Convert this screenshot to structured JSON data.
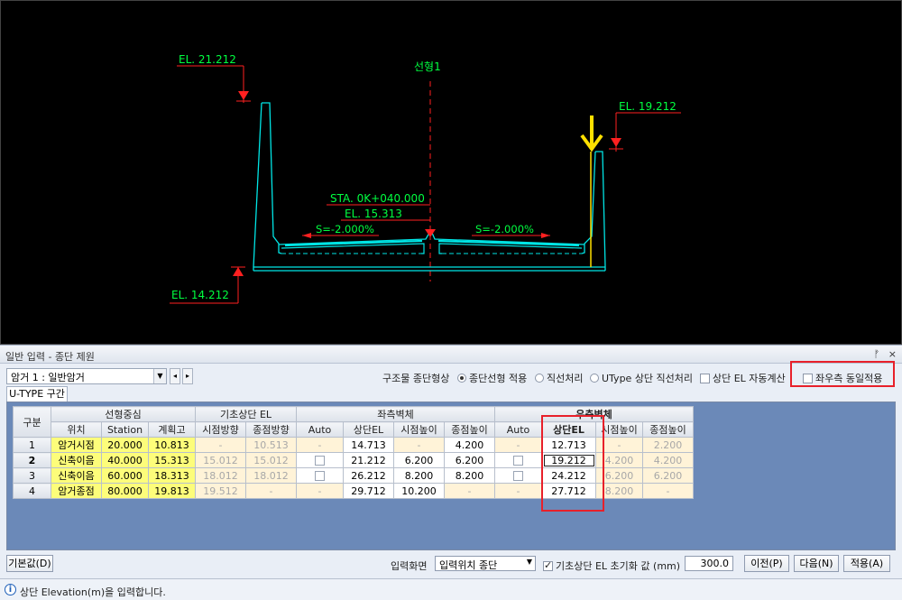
{
  "cad": {
    "labels": {
      "el_left_top": "EL. 21.212",
      "el_right_top": "EL. 19.212",
      "el_bottom": "EL. 14.212",
      "station": "STA. 0K+040.000",
      "el_center": "EL. 15.313",
      "slope_left": "S=-2.000%",
      "slope_right": "S=-2.000%",
      "alignment": "선형1"
    },
    "colors": {
      "structure": "#00e5e5",
      "text": "#00ff40",
      "marker": "#ff2020",
      "highlight": "#ffe000"
    }
  },
  "dialog": {
    "title": "일반 입력 - 종단 제원",
    "pin": "ᚠ",
    "close": "×",
    "culvert_select": "암거 1 : 일반암거",
    "structure_label": "구조물 종단형상",
    "options": {
      "align_apply": "종단선형 적용",
      "straight": "직선처리",
      "utype": "UType 상단 직선처리",
      "auto_calc": "상단 EL 자동계산",
      "both_sides": "좌우측 동일적용"
    },
    "tab": "U-TYPE 구간",
    "grid": {
      "group_headers": {
        "division": "구분",
        "center": "선형중심",
        "base": "기초상단 EL",
        "left_wall": "좌측벽체",
        "right_wall": "우측벽체"
      },
      "sub_headers": {
        "position": "위치",
        "station": "Station",
        "plan_height": "계획고",
        "start_dir": "시점방향",
        "end_dir": "종점방향",
        "auto": "Auto",
        "top_el": "상단EL",
        "start_h": "시점높이",
        "end_h": "종점높이"
      },
      "rows": [
        {
          "no": "1",
          "pos": "암거시점",
          "sta": "20.000",
          "plan": "10.813",
          "bs": "-",
          "be": "10.513",
          "la": "-",
          "lt": "14.713",
          "ls": "-",
          "le": "4.200",
          "ra": "-",
          "rt": "12.713",
          "rs": "-",
          "re": "2.200"
        },
        {
          "no": "2",
          "pos": "신축이음",
          "sta": "40.000",
          "plan": "15.313",
          "bs": "15.012",
          "be": "15.012",
          "la": "",
          "lt": "21.212",
          "ls": "6.200",
          "le": "6.200",
          "ra": "",
          "rt": "19.212",
          "rs": "4.200",
          "re": "4.200"
        },
        {
          "no": "3",
          "pos": "신축이음",
          "sta": "60.000",
          "plan": "18.313",
          "bs": "18.012",
          "be": "18.012",
          "la": "",
          "lt": "26.212",
          "ls": "8.200",
          "le": "8.200",
          "ra": "",
          "rt": "24.212",
          "rs": "6.200",
          "re": "6.200"
        },
        {
          "no": "4",
          "pos": "암거종점",
          "sta": "80.000",
          "plan": "19.813",
          "bs": "19.512",
          "be": "-",
          "la": "-",
          "lt": "29.712",
          "ls": "10.200",
          "le": "-",
          "ra": "-",
          "rt": "27.712",
          "rs": "8.200",
          "re": "-"
        }
      ]
    },
    "bottom": {
      "default_btn": "기본값(D)",
      "input_screen_label": "입력화면",
      "input_screen_value": "입력위치 종단",
      "base_init_label": "기초상단 EL 초기화 값 (mm)",
      "base_init_value": "300.0",
      "prev_btn": "이전(P)",
      "next_btn": "다음(N)",
      "apply_btn": "적용(A)"
    },
    "status": "상단 Elevation(m)을 입력합니다."
  }
}
